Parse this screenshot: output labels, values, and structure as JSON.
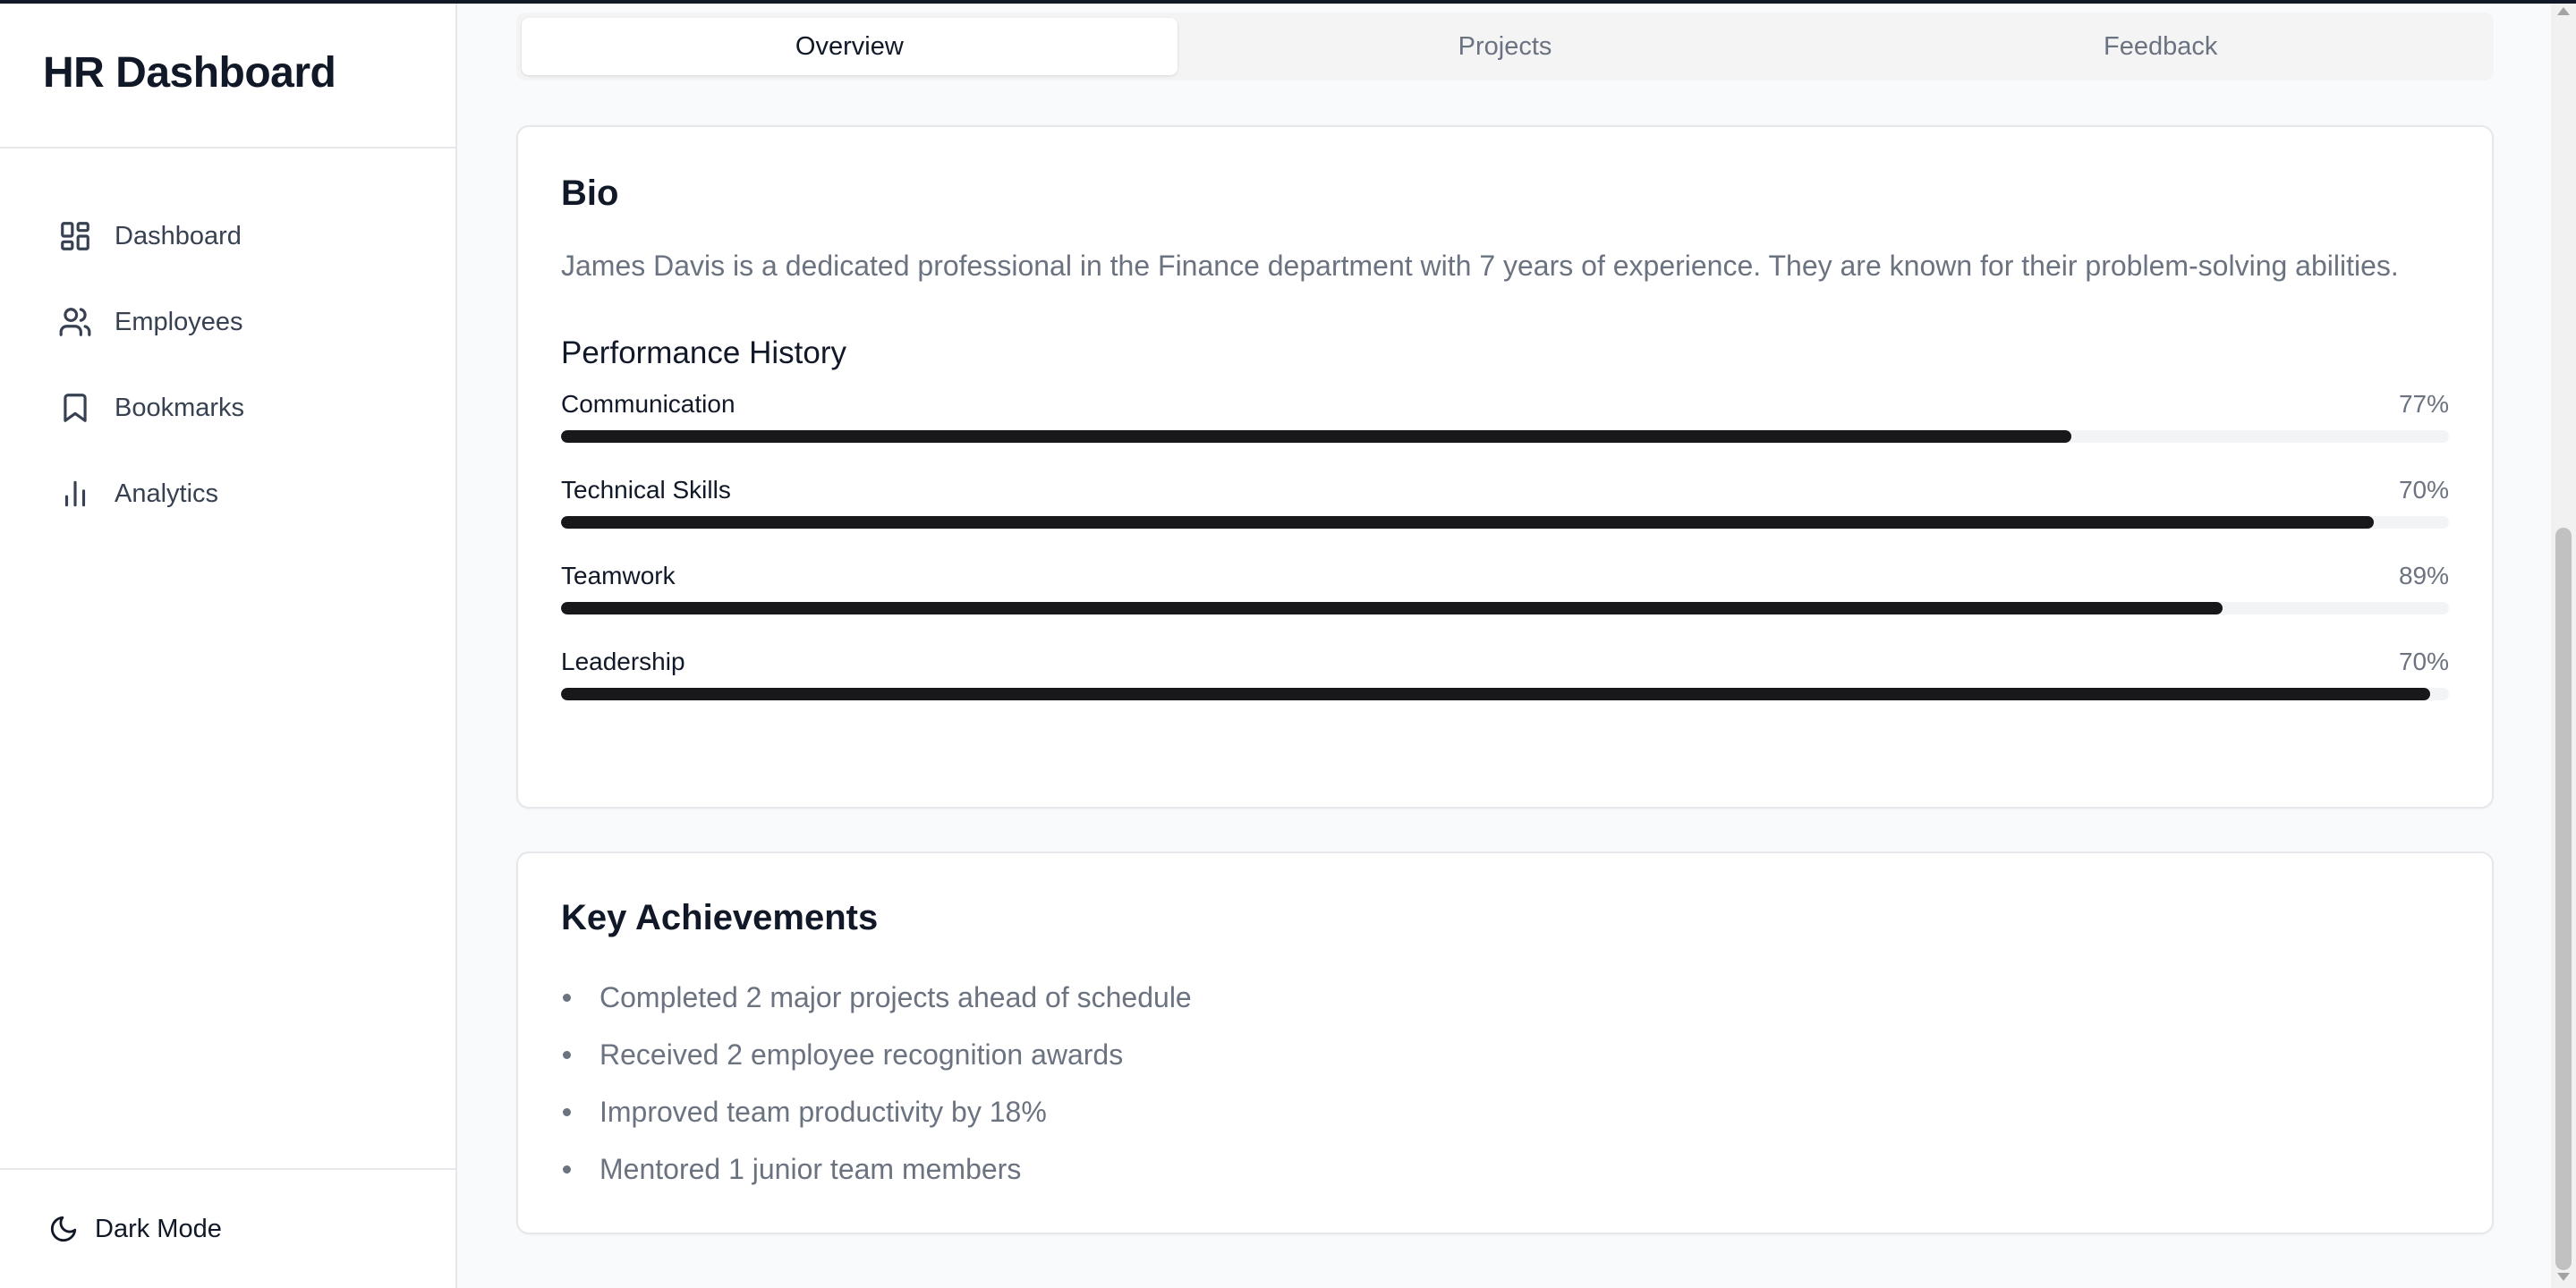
{
  "app": {
    "title": "HR Dashboard"
  },
  "sidebar": {
    "items": [
      {
        "label": "Dashboard",
        "icon": "dashboard-grid-icon"
      },
      {
        "label": "Employees",
        "icon": "users-icon"
      },
      {
        "label": "Bookmarks",
        "icon": "bookmark-icon"
      },
      {
        "label": "Analytics",
        "icon": "bar-chart-icon"
      }
    ],
    "footer": {
      "label": "Dark Mode",
      "icon": "moon-icon"
    }
  },
  "tabs": [
    {
      "label": "Overview",
      "active": true
    },
    {
      "label": "Projects",
      "active": false
    },
    {
      "label": "Feedback",
      "active": false
    }
  ],
  "bio": {
    "heading": "Bio",
    "text": "James Davis is a dedicated professional in the Finance department with 7 years of experience. They are known for their problem-solving abilities."
  },
  "performance": {
    "heading": "Performance History",
    "metrics": [
      {
        "label": "Communication",
        "pct": "77%",
        "fill": 0.8
      },
      {
        "label": "Technical Skills",
        "pct": "70%",
        "fill": 0.96
      },
      {
        "label": "Teamwork",
        "pct": "89%",
        "fill": 0.88
      },
      {
        "label": "Leadership",
        "pct": "70%",
        "fill": 0.99
      }
    ]
  },
  "achievements": {
    "heading": "Key Achievements",
    "items": [
      "Completed 2 major projects ahead of schedule",
      "Received 2 employee recognition awards",
      "Improved team productivity by 18%",
      "Mentored 1 junior team members"
    ]
  },
  "colors": {
    "bar_fill": "#18181b",
    "bar_track": "#f3f4f6",
    "muted_text": "#6b7280"
  }
}
